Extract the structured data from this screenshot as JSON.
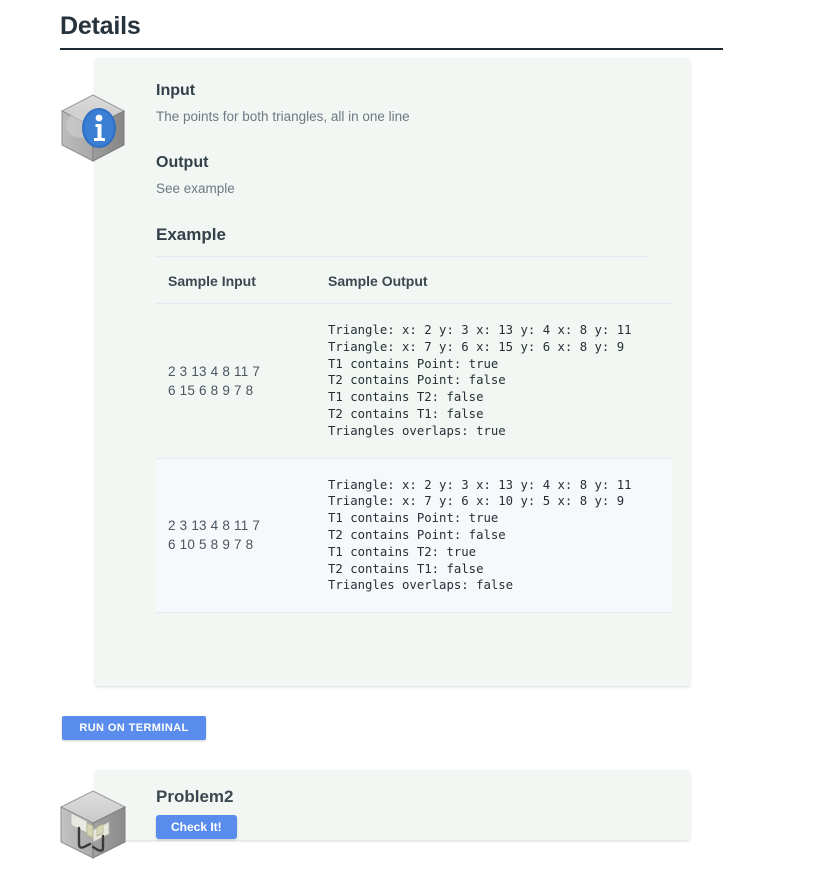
{
  "page": {
    "title": "Details"
  },
  "details": {
    "icon": "info-cube-icon",
    "input": {
      "heading": "Input",
      "text": "The points for both triangles, all in one line"
    },
    "output": {
      "heading": "Output",
      "text": "See example"
    },
    "example": {
      "heading": "Example",
      "columns": [
        "Sample Input",
        "Sample Output"
      ],
      "rows": [
        {
          "input": "2 3 13 4 8 11 7\n6 15 6 8 9 7 8",
          "output": "Triangle: x: 2 y: 3 x: 13 y: 4 x: 8 y: 11\nTriangle: x: 7 y: 6 x: 15 y: 6 x: 8 y: 9\nT1 contains Point: true\nT2 contains Point: false\nT1 contains T2: false\nT2 contains T1: false\nTriangles overlaps: true"
        },
        {
          "input": "2 3 13 4 8 11 7\n6 10 5 8 9 7 8",
          "output": "Triangle: x: 2 y: 3 x: 13 y: 4 x: 8 y: 11\nTriangle: x: 7 y: 6 x: 10 y: 5 x: 8 y: 9\nT1 contains Point: true\nT2 contains Point: false\nT1 contains T2: true\nT2 contains T1: false\nTriangles overlaps: false"
        }
      ]
    }
  },
  "actions": {
    "run_on_terminal": "RUN ON TERMINAL"
  },
  "problem": {
    "icon": "problem-cube-icon",
    "title": "Problem2",
    "check_label": "Check It!"
  },
  "colors": {
    "accent_blue": "#5a8cee",
    "panel_bg": "#f2f7f3",
    "row_alt_bg": "#f7f8fc",
    "rule": "#e2eaf2",
    "title_rule": "#1d2b35"
  }
}
